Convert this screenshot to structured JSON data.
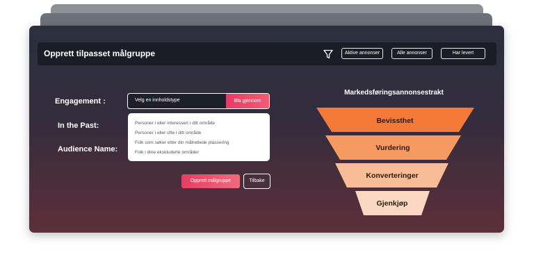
{
  "header": {
    "title": "Opprett tilpasset målgruppe",
    "filter_icon": "filter-icon",
    "buttons": [
      "Aktive annonser",
      "Alle annonser",
      "Har levert"
    ]
  },
  "form": {
    "engagement_label": "Engagement :",
    "past_label": "In the Past:",
    "audience_label": "Audience Name:",
    "select_placeholder": "Velg en innholdstype",
    "browse_label": "Bla gjennom",
    "options": [
      "Personer i eller interessert i ditt område",
      "Personer i eller ofte i ditt område",
      "Folk som søker etter din målrettede plassering",
      "Folk i dine ekskluderte områder"
    ],
    "create_label": "Opprett målgruppe",
    "back_label": "Tilbake"
  },
  "funnel": {
    "title": "Markedsføringsannonsestrakt",
    "stages": [
      {
        "label": "Bevissthet",
        "color": "#f47a3a",
        "text_color": "#2a1a12"
      },
      {
        "label": "Vurdering",
        "color": "#f69a62",
        "text_color": "#2a1a12"
      },
      {
        "label": "Konverteringer",
        "color": "#f8bc97",
        "text_color": "#2a1a12"
      },
      {
        "label": "Gjenkjøp",
        "color": "#fad8c2",
        "text_color": "#2a1a12"
      }
    ]
  }
}
